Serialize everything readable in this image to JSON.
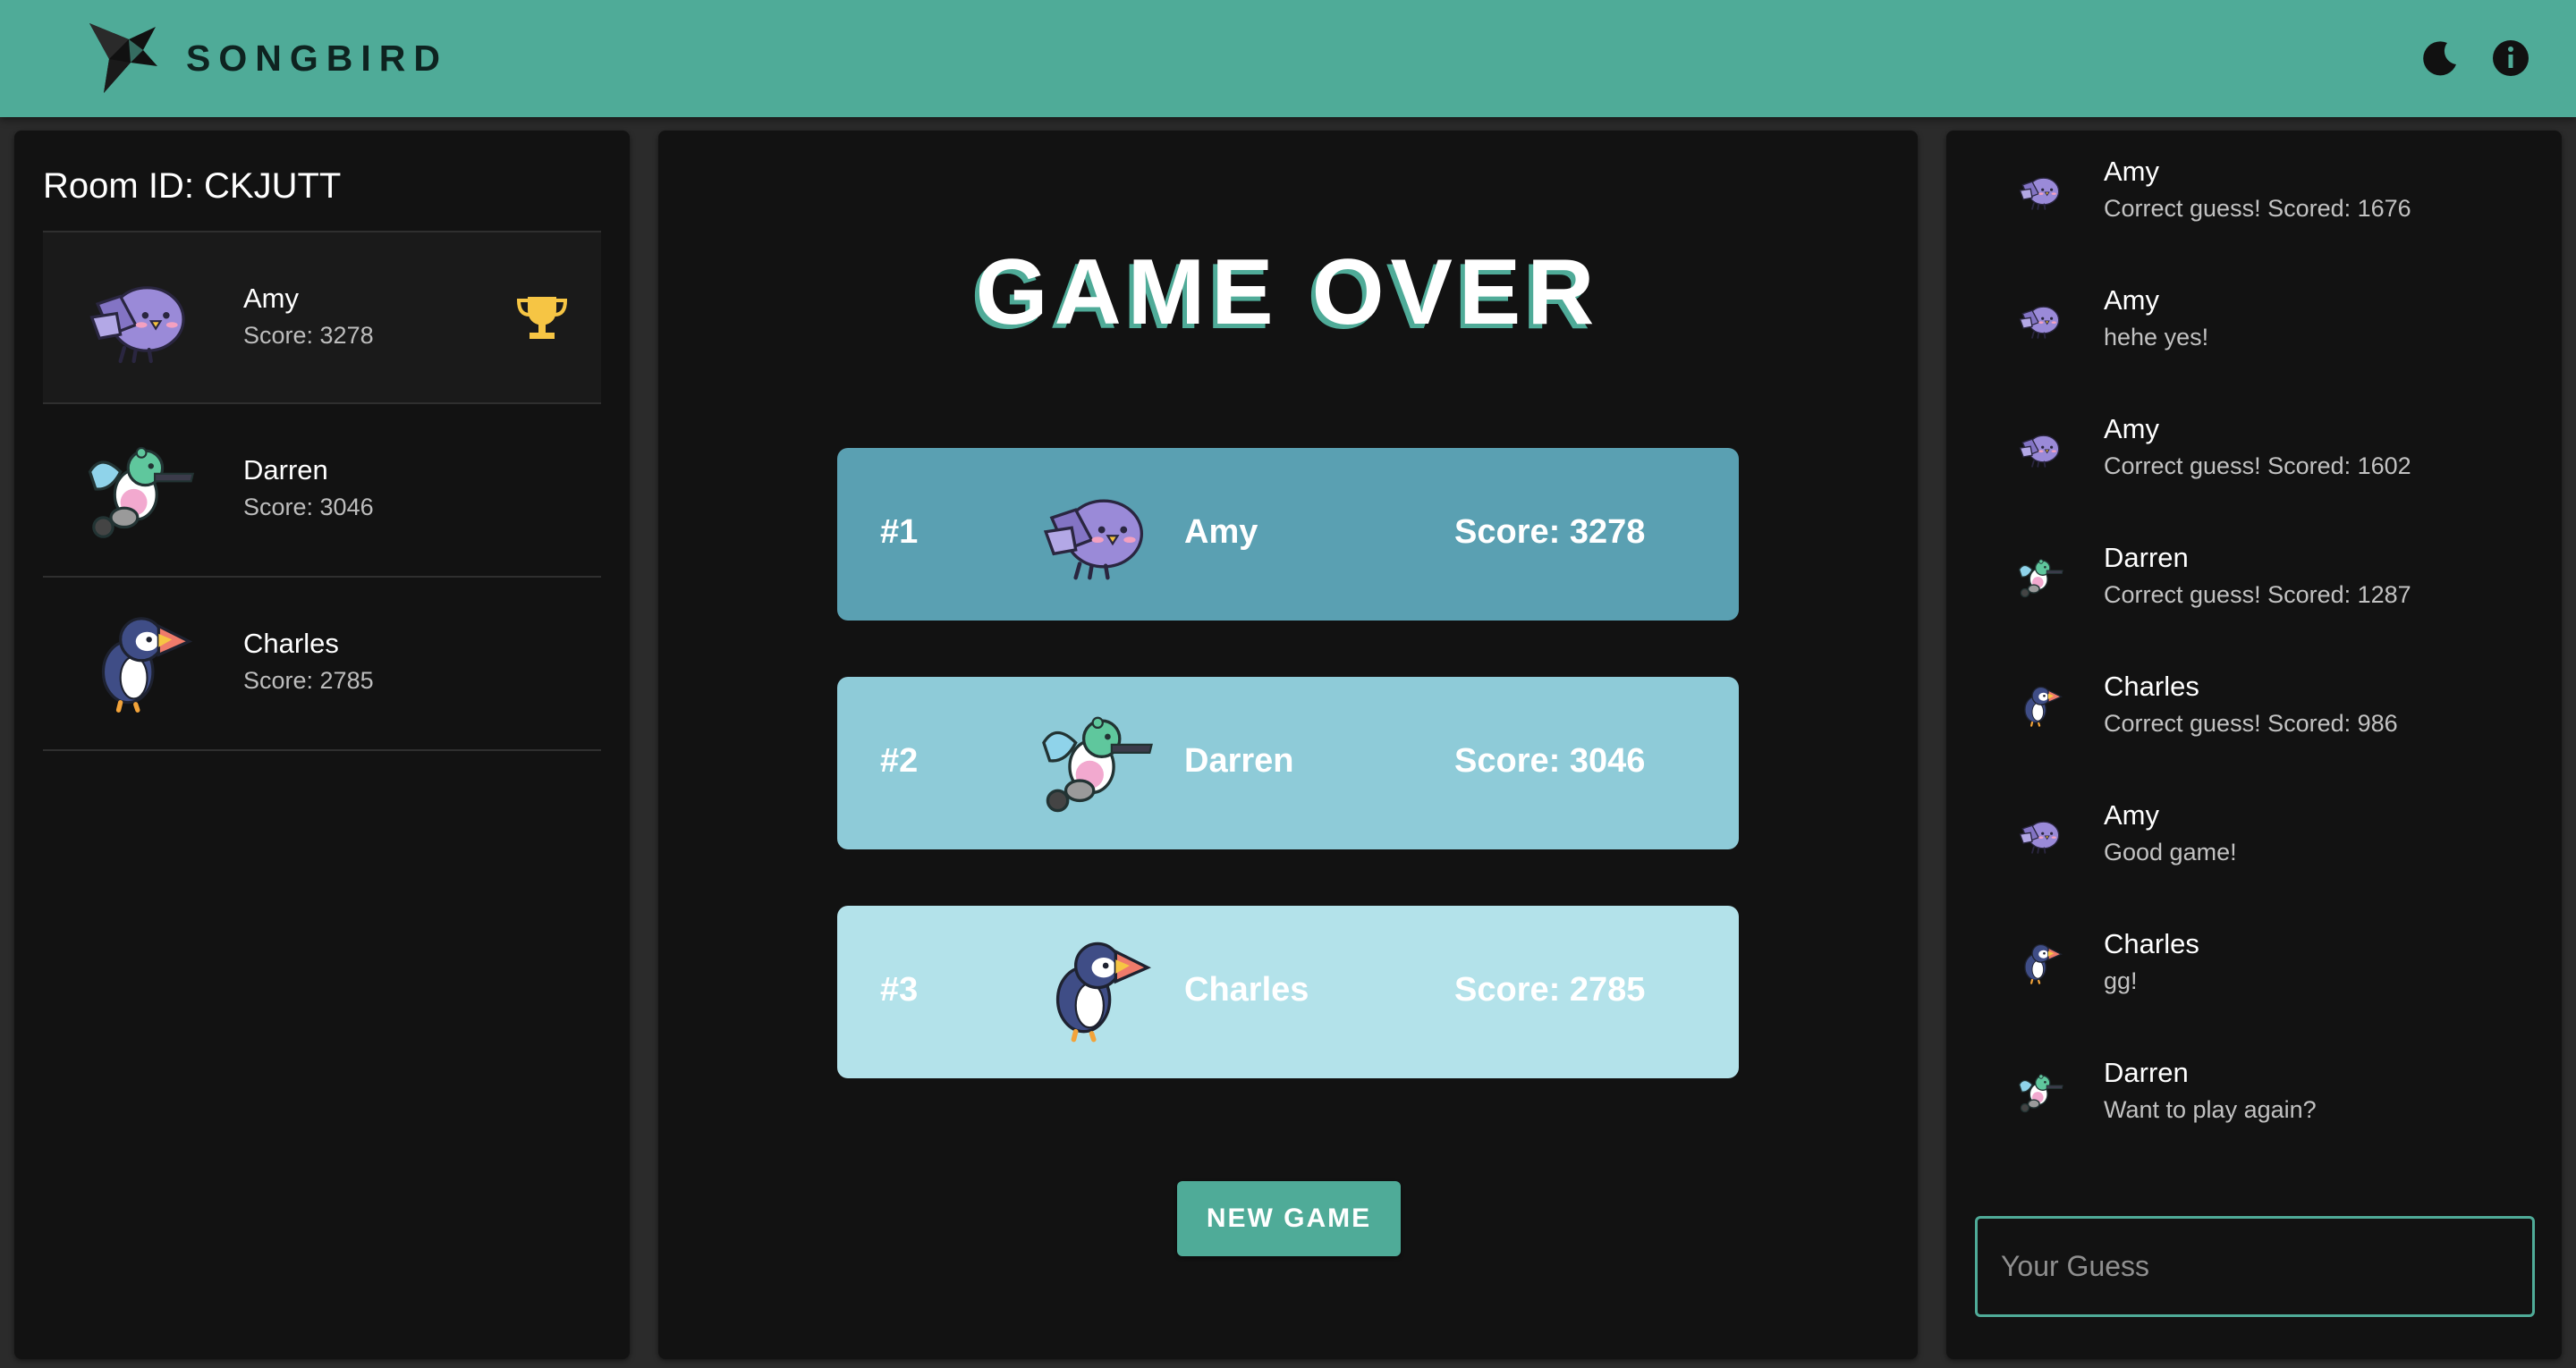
{
  "appbar": {
    "brand": "SONGBIRD",
    "logo_icon": "origami-bird-logo",
    "actions": [
      {
        "icon": "moon-icon",
        "label": "dark-mode-toggle"
      },
      {
        "icon": "info-icon",
        "label": "info"
      }
    ]
  },
  "room": {
    "title": "Room ID: CKJUTT"
  },
  "players": [
    {
      "name": "Amy",
      "score": "Score: 3278",
      "bird": "purple",
      "leader": true
    },
    {
      "name": "Darren",
      "score": "Score: 3046",
      "bird": "hummingbird",
      "leader": false
    },
    {
      "name": "Charles",
      "score": "Score: 2785",
      "bird": "puffin",
      "leader": false
    }
  ],
  "game": {
    "title": "GAME OVER",
    "ranking": [
      {
        "rank": "#1",
        "name": "Amy",
        "score": "Score: 3278",
        "bird": "purple"
      },
      {
        "rank": "#2",
        "name": "Darren",
        "score": "Score: 3046",
        "bird": "hummingbird"
      },
      {
        "rank": "#3",
        "name": "Charles",
        "score": "Score: 2785",
        "bird": "puffin"
      }
    ],
    "new_game_label": "NEW GAME"
  },
  "chat": {
    "messages": [
      {
        "name": "Amy",
        "text": "Correct guess! Scored: 1676",
        "bird": "purple"
      },
      {
        "name": "Amy",
        "text": "hehe yes!",
        "bird": "purple"
      },
      {
        "name": "Amy",
        "text": "Correct guess! Scored: 1602",
        "bird": "purple"
      },
      {
        "name": "Darren",
        "text": "Correct guess! Scored: 1287",
        "bird": "hummingbird"
      },
      {
        "name": "Charles",
        "text": "Correct guess! Scored: 986",
        "bird": "puffin"
      },
      {
        "name": "Amy",
        "text": "Good game!",
        "bird": "purple"
      },
      {
        "name": "Charles",
        "text": "gg!",
        "bird": "puffin"
      },
      {
        "name": "Darren",
        "text": "Want to play again?",
        "bird": "hummingbird"
      }
    ],
    "input_placeholder": "Your Guess"
  },
  "colors": {
    "accent": "#4fab98",
    "background": "#121212",
    "rank_1": "#5aa0b2",
    "rank_2": "#8ecbd8",
    "rank_3": "#b3e2ea",
    "trophy": "#f6c544"
  }
}
